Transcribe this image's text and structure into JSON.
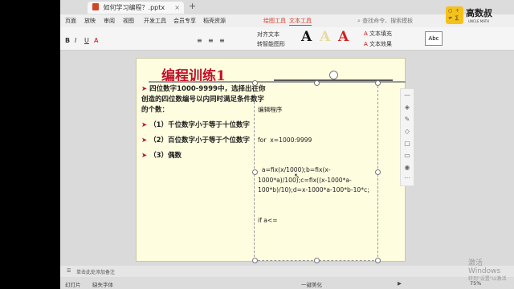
{
  "window": {
    "tab_title": "如何学习编程？.pptx",
    "new_tab_symbol": "+"
  },
  "menu": {
    "items": [
      "页面",
      "放映",
      "审阅",
      "视图",
      "开发工具",
      "会员专享",
      "稻壳资源"
    ],
    "drawing_tools": "绘图工具",
    "text_tools": "文本工具",
    "search": "查找命令、搜索模板"
  },
  "ribbon": {
    "text_fill": "文本填充",
    "text_effect": "文本效果",
    "align_text": "对齐文本",
    "convert_smartart": "转智能图形",
    "abc": "Abc"
  },
  "logo": {
    "text": "高数叔",
    "sub": "UNCLE MATH"
  },
  "slide": {
    "title": "编程训练1",
    "paragraphs": [
      "四位数字1000-9999中，选择出在你创造的四位数编号以内同时满足条件数字的个数：",
      "（1）千位数字小于等于十位数字",
      "（2）百位数字小于等于个位数字",
      "（3）偶数"
    ],
    "code_lines": [
      "编辑程序",
      "for  x=1000:9999",
      "  a=fix(x/1000);b=fix(x-1000*a)/100);c=fix((x-1000*a-100*b)/10);d=x-1000*a-100*b-10*c;",
      "if a<="
    ]
  },
  "notes": {
    "placeholder": "单击此处添加备注"
  },
  "status": {
    "left": "幻灯片",
    "font_missing": "缺失字体",
    "beautify": "一键美化",
    "zoom": "75%"
  },
  "watermark": {
    "line1": "激活 Windows",
    "line2": "转到\"设置\"以激活"
  }
}
